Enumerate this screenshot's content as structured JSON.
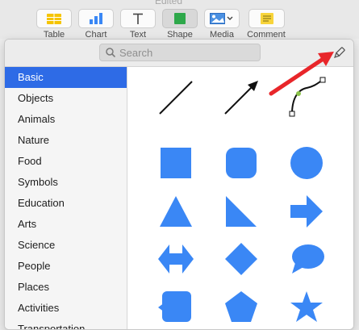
{
  "window": {
    "title": "Edited"
  },
  "toolbar": {
    "buttons": [
      {
        "label": "Table"
      },
      {
        "label": "Chart"
      },
      {
        "label": "Text"
      },
      {
        "label": "Shape"
      },
      {
        "label": "Media"
      },
      {
        "label": "Comment"
      }
    ]
  },
  "search": {
    "placeholder": "Search"
  },
  "categories": [
    "Basic",
    "Objects",
    "Animals",
    "Nature",
    "Food",
    "Symbols",
    "Education",
    "Arts",
    "Science",
    "People",
    "Places",
    "Activities",
    "Transportation"
  ],
  "selected_category": "Basic",
  "shapes": [
    "line",
    "arrow-line",
    "curve",
    "square",
    "rounded-square",
    "circle",
    "triangle",
    "right-triangle",
    "arrow-right",
    "double-arrow",
    "diamond",
    "speech-bubble",
    "callout-square",
    "pentagon",
    "star"
  ],
  "colors": {
    "shape": "#3a87f5",
    "accent": "#2e6be6",
    "annotation": "#e8262a"
  }
}
